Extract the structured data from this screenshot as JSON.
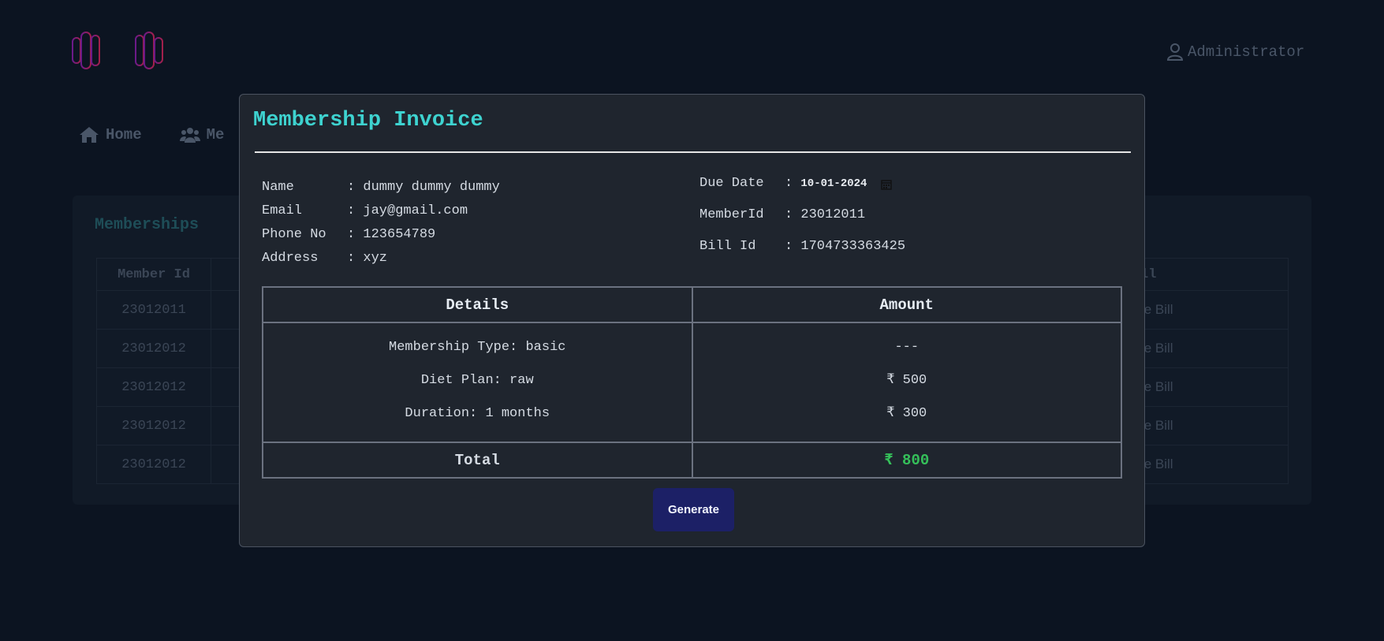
{
  "header": {
    "logo_icon": "dumbbell-icon",
    "user_icon": "user-icon",
    "user_label": "Administrator"
  },
  "nav": {
    "items": [
      {
        "icon": "home-icon",
        "label": "Home"
      },
      {
        "icon": "users-icon",
        "label": "Me"
      }
    ]
  },
  "background": {
    "card_title": "Memberships",
    "table_headers": {
      "first": "Member Id",
      "last": "ll"
    },
    "rows": [
      {
        "member_id": "23012011",
        "action": "te Bill"
      },
      {
        "member_id": "23012012",
        "action": "te Bill"
      },
      {
        "member_id": "23012012",
        "action": "te Bill"
      },
      {
        "member_id": "23012012",
        "action": "te Bill"
      },
      {
        "member_id": "23012012",
        "action": "te Bill"
      }
    ]
  },
  "modal": {
    "title": "Membership Invoice",
    "left_info": [
      {
        "label": "Name",
        "value": "dummy dummy dummy"
      },
      {
        "label": "Email",
        "value": "jay@gmail.com"
      },
      {
        "label": "Phone No",
        "value": "123654789"
      },
      {
        "label": "Address",
        "value": "xyz"
      }
    ],
    "due_date_label": "Due Date",
    "due_date_value": "10-01-2024",
    "member_id_label": "MemberId",
    "member_id_value": "23012011",
    "bill_id_label": "Bill Id",
    "bill_id_value": "1704733363425",
    "separator": ":",
    "table": {
      "col_details": "Details",
      "col_amount": "Amount",
      "items": [
        {
          "detail": "Membership Type: basic",
          "amount": "---"
        },
        {
          "detail": "Diet Plan: raw",
          "amount": "₹ 500"
        },
        {
          "detail": "Duration: 1 months",
          "amount": "₹ 300"
        }
      ],
      "total_label": "Total",
      "total_value": "₹ 800"
    },
    "generate_label": "Generate"
  },
  "colors": {
    "accent_title": "#3ed3d0",
    "total_green": "#35c05a",
    "button_bg": "#1c2066"
  }
}
